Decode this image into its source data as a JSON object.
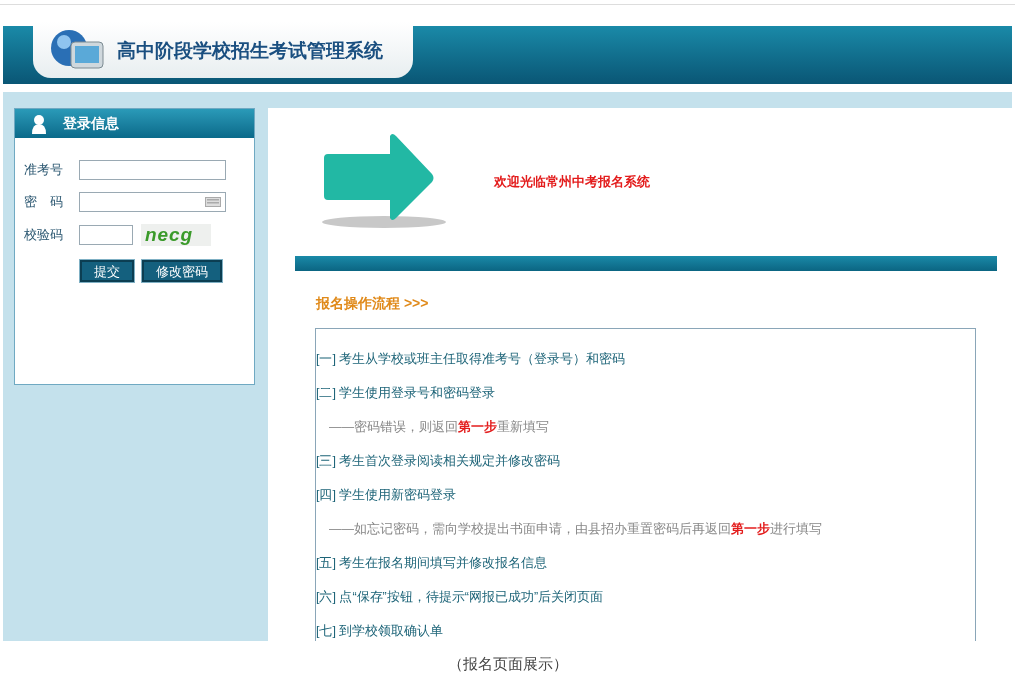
{
  "header": {
    "title": "高中阶段学校招生考试管理系统"
  },
  "login": {
    "title": "登录信息",
    "fields": [
      {
        "kind": "text",
        "label": "准考号"
      },
      {
        "kind": "password",
        "label": "密　码"
      },
      {
        "kind": "captcha",
        "label": "校验码",
        "captcha": "necg"
      }
    ],
    "buttons": [
      "提交",
      "修改密码"
    ]
  },
  "welcome": "欢迎光临常州中考报名系统",
  "process": {
    "title": "报名操作流程 >>>",
    "steps": [
      {
        "kind": "step",
        "parts": [
          {
            "text": "[一] 考生从学校或班主任取得准考号（登录号）和密码",
            "highlight": false
          }
        ]
      },
      {
        "kind": "step",
        "parts": [
          {
            "text": "[二] 学生使用登录号和密码登录",
            "highlight": false
          }
        ]
      },
      {
        "kind": "note",
        "parts": [
          {
            "text": "——密码错误，则返回",
            "highlight": false
          },
          {
            "text": "第一步",
            "highlight": true
          },
          {
            "text": "重新填写",
            "highlight": false
          }
        ]
      },
      {
        "kind": "step",
        "parts": [
          {
            "text": "[三] 考生首次登录阅读相关规定并修改密码",
            "highlight": false
          }
        ]
      },
      {
        "kind": "step",
        "parts": [
          {
            "text": "[四] 学生使用新密码登录",
            "highlight": false
          }
        ]
      },
      {
        "kind": "note",
        "parts": [
          {
            "text": "——如忘记密码，需向学校提出书面申请，由县招办重置密码后再返回",
            "highlight": false
          },
          {
            "text": "第一步",
            "highlight": true
          },
          {
            "text": "进行填写",
            "highlight": false
          }
        ]
      },
      {
        "kind": "step",
        "parts": [
          {
            "text": "[五] 考生在报名期间填写并修改报名信息",
            "highlight": false
          }
        ]
      },
      {
        "kind": "step",
        "parts": [
          {
            "text": "[六] 点“保存”按钮，待提示“网报已成功”后关闭页面",
            "highlight": false
          }
        ]
      },
      {
        "kind": "step",
        "parts": [
          {
            "text": "[七] 到学校领取确认单",
            "highlight": false
          }
        ]
      }
    ]
  },
  "caption": "（报名页面展示）"
}
